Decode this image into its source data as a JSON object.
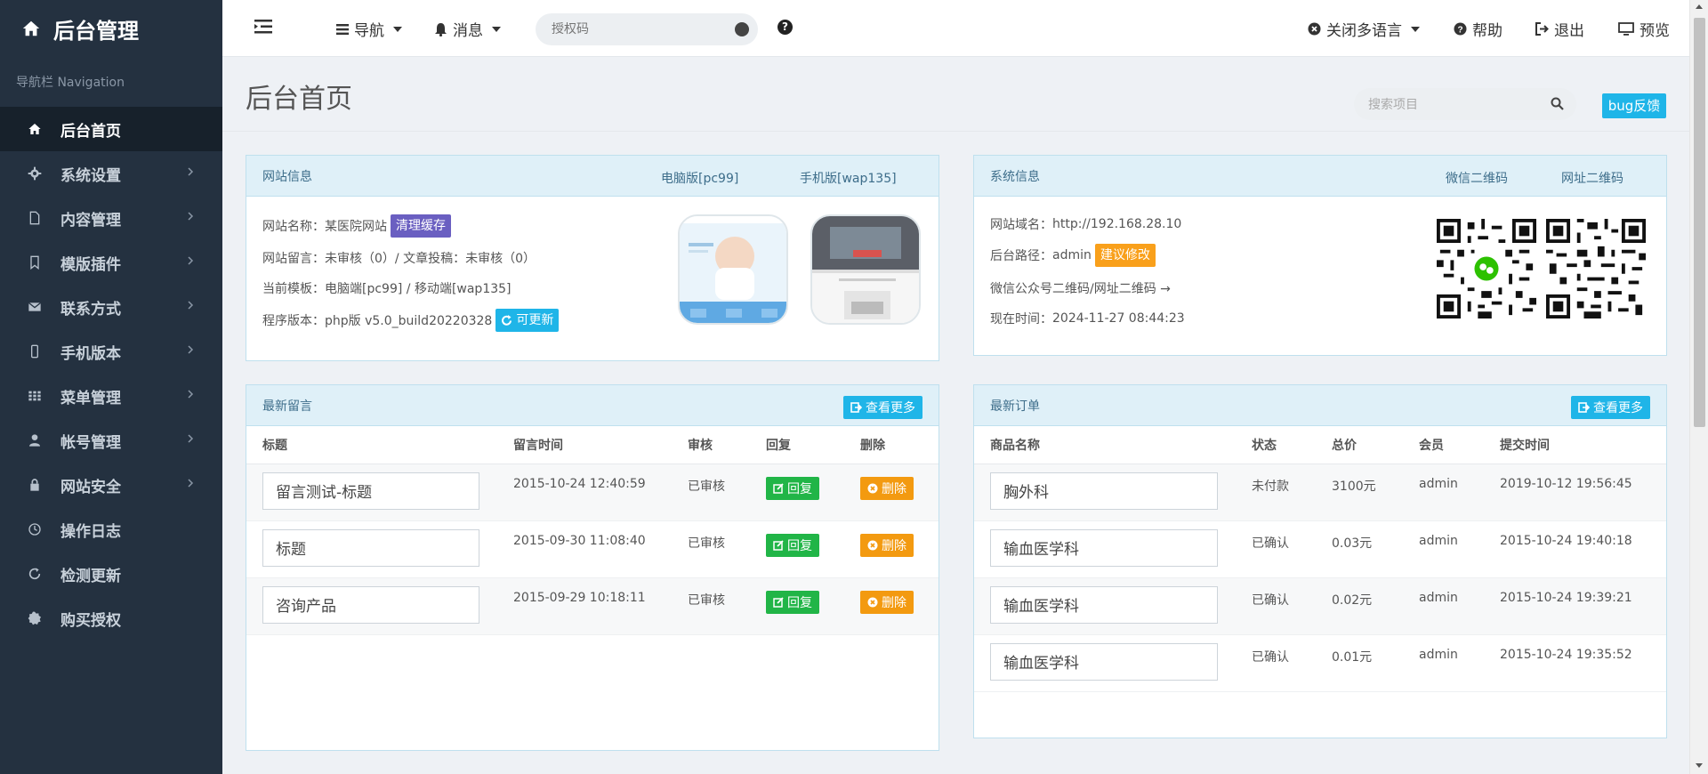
{
  "sidebar": {
    "brand": "后台管理",
    "caption": "导航栏 Navigation",
    "items": [
      {
        "label": "后台首页",
        "icon": "home-icon"
      },
      {
        "label": "系统设置",
        "icon": "gear-icon"
      },
      {
        "label": "内容管理",
        "icon": "file-icon"
      },
      {
        "label": "模版插件",
        "icon": "bookmark-icon"
      },
      {
        "label": "联系方式",
        "icon": "envelope-icon"
      },
      {
        "label": "手机版本",
        "icon": "mobile-icon"
      },
      {
        "label": "菜单管理",
        "icon": "grid-icon"
      },
      {
        "label": "帐号管理",
        "icon": "user-icon"
      },
      {
        "label": "网站安全",
        "icon": "lock-icon"
      },
      {
        "label": "操作日志",
        "icon": "clock-icon"
      },
      {
        "label": "检测更新",
        "icon": "refresh-icon"
      },
      {
        "label": "购买授权",
        "icon": "certificate-icon"
      }
    ]
  },
  "topbar": {
    "nav": "导航",
    "messages": "消息",
    "auth_placeholder": "授权码",
    "close_lang": "关闭多语言",
    "help": "帮助",
    "logout": "退出",
    "preview": "预览"
  },
  "page": {
    "title": "后台首页",
    "search_placeholder": "搜索项目",
    "bug_feedback": "bug反馈"
  },
  "site_info": {
    "title": "网站信息",
    "pc_link": "电脑版[pc99]",
    "wap_link": "手机版[wap135]",
    "name_label": "网站名称：",
    "name_value": "某医院网站",
    "clear_cache": "清理缓存",
    "msg_label": "网站留言：",
    "msg_value": "未审核（0）/ 文章投稿：未审核（0）",
    "tpl_label": "当前模板：",
    "tpl_value": "电脑端[pc99] / 移动端[wap135]",
    "ver_label": "程序版本：",
    "ver_value": "php版 v5.0_build20220328",
    "update_btn": "可更新"
  },
  "sys_info": {
    "title": "系统信息",
    "wechat_qr": "微信二维码",
    "url_qr": "网址二维码",
    "domain_label": "网站域名：",
    "domain_value": "http://192.168.28.10",
    "path_label": "后台路径：",
    "path_value": "admin",
    "suggest_btn": "建议修改",
    "qr_text": "微信公众号二维码/网址二维码 →",
    "time_label": "现在时间：",
    "time_value": "2024-11-27 08:44:23"
  },
  "messages": {
    "title": "最新留言",
    "more": "查看更多",
    "headers": [
      "标题",
      "留言时间",
      "审核",
      "回复",
      "删除"
    ],
    "rows": [
      {
        "title": "留言测试-标题",
        "time": "2015-10-24 12:40:59",
        "status": "已审核",
        "reply": "回复",
        "delete": "删除"
      },
      {
        "title": "标题",
        "time": "2015-09-30 11:08:40",
        "status": "已审核",
        "reply": "回复",
        "delete": "删除"
      },
      {
        "title": "咨询产品",
        "time": "2015-09-29 10:18:11",
        "status": "已审核",
        "reply": "回复",
        "delete": "删除"
      }
    ]
  },
  "orders": {
    "title": "最新订单",
    "more": "查看更多",
    "headers": [
      "商品名称",
      "状态",
      "总价",
      "会员",
      "提交时间"
    ],
    "rows": [
      {
        "name": "胸外科",
        "status": "未付款",
        "price": "3100元",
        "member": "admin",
        "time": "2019-10-12 19:56:45"
      },
      {
        "name": "输血医学科",
        "status": "已确认",
        "price": "0.03元",
        "member": "admin",
        "time": "2015-10-24 19:40:18"
      },
      {
        "name": "输血医学科",
        "status": "已确认",
        "price": "0.02元",
        "member": "admin",
        "time": "2015-10-24 19:39:21"
      },
      {
        "name": "输血医学科",
        "status": "已确认",
        "price": "0.01元",
        "member": "admin",
        "time": "2015-10-24 19:35:52"
      }
    ]
  },
  "colors": {
    "sidebar_bg": "#243140",
    "accent_blue": "#1fb5e8",
    "panel_head": "#dff0f8",
    "tag_purple": "#6a5fc1",
    "tag_orange": "#f9a01b",
    "btn_green": "#21b547",
    "ok_green": "#1c9a2c"
  }
}
